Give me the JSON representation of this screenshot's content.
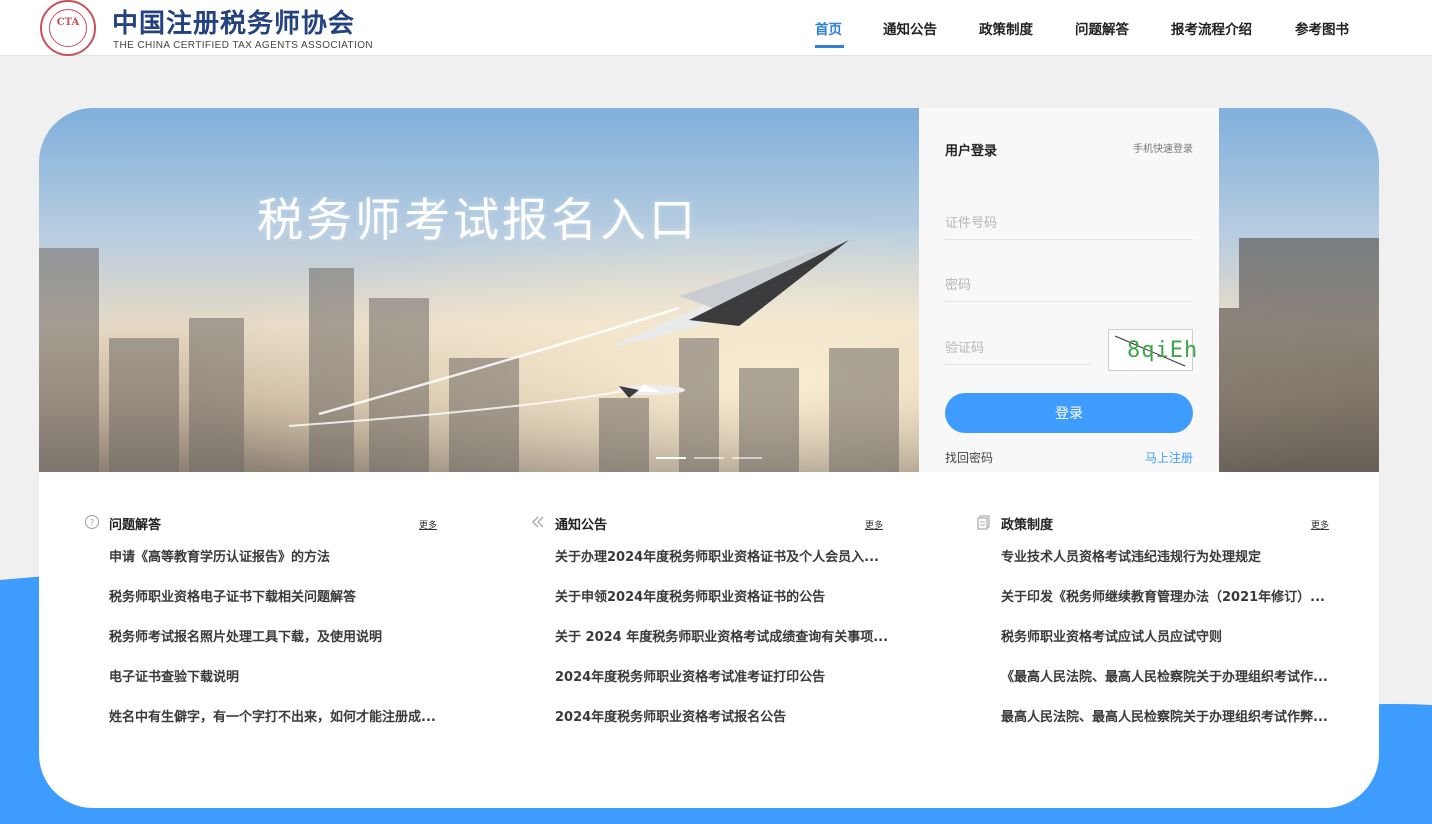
{
  "header": {
    "logo_cn": "中国注册税务师协会",
    "logo_en": "THE CHINA CERTIFIED TAX AGENTS ASSOCIATION",
    "nav": [
      {
        "label": "首页",
        "active": true
      },
      {
        "label": "通知公告",
        "active": false
      },
      {
        "label": "政策制度",
        "active": false
      },
      {
        "label": "问题解答",
        "active": false
      },
      {
        "label": "报考流程介绍",
        "active": false
      },
      {
        "label": "参考图书",
        "active": false
      }
    ]
  },
  "banner": {
    "title": "税务师考试报名入口",
    "slides_total": 3,
    "active_slide": 1
  },
  "login": {
    "title": "用户登录",
    "quick_login": "手机快速登录",
    "id_placeholder": "证件号码",
    "password_placeholder": "密码",
    "captcha_placeholder": "验证码",
    "captcha_text": "8qiEh",
    "submit": "登录",
    "forgot": "找回密码",
    "register": "马上注册"
  },
  "columns": [
    {
      "icon": "question-circle-icon",
      "title": "问题解答",
      "more": "更多",
      "items": [
        "申请《高等教育学历认证报告》的方法",
        "税务师职业资格电子证书下载相关问题解答",
        "税务师考试报名照片处理工具下载，及使用说明",
        "电子证书查验下载说明",
        "姓名中有生僻字，有一个字打不出来，如何才能注册成..."
      ]
    },
    {
      "icon": "double-chevron-left-icon",
      "title": "通知公告",
      "more": "更多",
      "items": [
        "关于办理2024年度税务师职业资格证书及个人会员入...",
        "关于申领2024年度税务师职业资格证书的公告",
        "关于 2024 年度税务师职业资格考试成绩查询有关事项...",
        "2024年度税务师职业资格考试准考证打印公告",
        "2024年度税务师职业资格考试报名公告"
      ]
    },
    {
      "icon": "document-stack-icon",
      "title": "政策制度",
      "more": "更多",
      "items": [
        "专业技术人员资格考试违纪违规行为处理规定",
        "关于印发《税务师继续教育管理办法（2021年修订）...",
        "税务师职业资格考试应试人员应试守则",
        "《最高人民法院、最高人民检察院关于办理组织考试作...",
        "最高人民法院、最高人民检察院关于办理组织考试作弊..."
      ]
    }
  ],
  "colors": {
    "brand_blue": "#24427f",
    "accent_blue": "#3f9cff",
    "nav_active": "#2f7fd6",
    "seal_red": "#c8505a"
  }
}
